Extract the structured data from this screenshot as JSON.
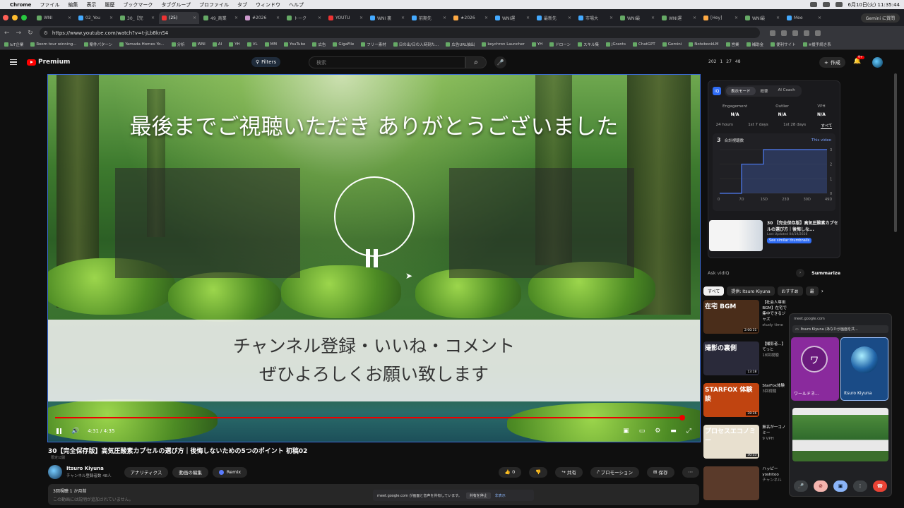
{
  "menubar": {
    "app": "Chrome",
    "items": [
      "ファイル",
      "編集",
      "表示",
      "履歴",
      "ブックマーク",
      "タブグループ",
      "プロファイル",
      "タブ",
      "ウィンドウ",
      "ヘルプ"
    ],
    "clock": "6月10日(火) 11:35:44"
  },
  "tabs": [
    "WNI",
    "02_You",
    "30_【完",
    "(25)",
    "49_商業",
    "#2026",
    "トーク",
    "YOUTU",
    "WNI 裏",
    "前期先",
    "★2026",
    "WNI運",
    "最新先",
    "市場大",
    "WNI最",
    "WNI運",
    "[Hey]",
    "WNI最",
    "Mee"
  ],
  "gemini_label": "Gemini に質問",
  "url": "https://www.youtube.com/watch?v=t-jLb8knS4",
  "bookmarks": [
    "IoT企業",
    "Room tour winning...",
    "案件パターン",
    "Yamada Homes Yo...",
    "分析",
    "WNI",
    "AI",
    "YH",
    "VL",
    "MM",
    "YouTube",
    "広告",
    "GigaFile",
    "フリー素材",
    "日の出/日の入時刻た...",
    "広告URL抽出",
    "keychron Launcher",
    "YH",
    "ドローン",
    "スキル集",
    "jGrants",
    "ChatGPT",
    "Gemini",
    "NotebookLM",
    "営業",
    "補助金",
    "便利サイト",
    "※援手続き系"
  ],
  "header": {
    "logo": "Premium",
    "filters": "Filters",
    "search_placeholder": "検索",
    "stats": [
      "202",
      "1",
      "27",
      "48"
    ],
    "create": "作成",
    "notifications": "9+"
  },
  "player": {
    "title_overlay": "最後までご視聴いただき ありがとうございました",
    "banner_line1": "チャンネル登録・いいね・コメント",
    "banner_line2": "ぜひよろしくお願い致します",
    "time": "4:31 / 4:35",
    "progress": 0.985
  },
  "video": {
    "title": "30【完全保存版】高気圧酸素カプセルの選び方｜後悔しないための5つのポイント 初稿02",
    "visibility": "限定公開",
    "channel": "Itsuro Kiyuna",
    "subs": "チャンネル登録者数 48人",
    "buttons": [
      "アナリティクス",
      "動画の編集",
      "Remix"
    ],
    "likes": "0",
    "actions": [
      "共有",
      "プロモーション",
      "保存"
    ],
    "desc_meta": "3回視聴 1 か月前",
    "desc_text": "この動画には説明が追加されていません。"
  },
  "vidiq": {
    "tabs": [
      "表示モード",
      "概要",
      "AI Coach"
    ],
    "metrics": [
      {
        "label": "Engagement",
        "value": "N/A"
      },
      {
        "label": "Outlier",
        "value": "N/A"
      },
      {
        "label": "VPH",
        "value": "N/A"
      }
    ],
    "ranges": [
      "24 hours",
      "1st 7 days",
      "1st 28 days",
      "すべて"
    ],
    "total": "3",
    "total_label": "合計視聴数",
    "this_video": "This video",
    "thumb_title": "30 【完全保存版】高気圧酸素カプセルの選び方｜後悔しな...",
    "thumb_updated": "Last Updated 04/19/2026",
    "similar": "See similar thumbnails",
    "ask": "Ask vidIQ",
    "summarize": "Summarize"
  },
  "chart_data": {
    "type": "line",
    "title": "",
    "x": [
      0,
      10,
      15,
      20,
      30,
      40,
      49
    ],
    "y": [
      0,
      2,
      2,
      3,
      3,
      3,
      3
    ],
    "x_ticks": [
      "0",
      "7D",
      "15D",
      "23D",
      "30D",
      "49D"
    ],
    "y_ticks": [
      "0",
      "1",
      "2",
      "3"
    ],
    "ylim": [
      0,
      3
    ],
    "line_color": "#4f7df5"
  },
  "chips": [
    "すべて",
    "提供: Itsuro Kiyuna",
    "おすすめ",
    "最"
  ],
  "recs": [
    {
      "thumb": "在宅 BGM",
      "dur": "2:00:31",
      "title": "【社会人専用BGM】在宅で集中できるジャズ",
      "meta": "study time",
      "color": "#4a2d1a"
    },
    {
      "thumb": "撮影の裏側",
      "dur": "13:18",
      "title": "【撮影者...】てっと",
      "meta": "18回視聴",
      "color": "#2a2a3a"
    },
    {
      "thumb": "STARFOX 体験談",
      "dur": "28:26",
      "title": "StarFox体験",
      "meta": "3回視聴",
      "color": "#c04410"
    },
    {
      "thumb": "プロセスエコノミー",
      "dur": "30:33",
      "title": "無名が一コノミー",
      "meta": "9 VPH",
      "color": "#e8e0cf"
    },
    {
      "thumb": "",
      "dur": "",
      "title": "ハッピー yoshitoo",
      "meta": "チャンネル",
      "color": "#5a3a2a"
    }
  ],
  "meet": {
    "url": "meet.google.com",
    "presenter": "Itsuro Kiyuna (あなたが画面を共...",
    "p1": "ワールドネ...",
    "p1_initial": "ワ",
    "p2": "Itsuro Kiyuna"
  },
  "share_bar": {
    "text": "meet.google.com が画面と音声を共有しています。",
    "stop": "共有を停止",
    "hide": "非表示"
  }
}
